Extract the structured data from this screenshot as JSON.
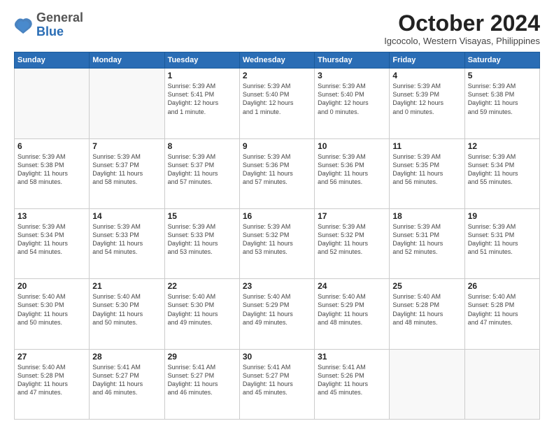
{
  "logo": {
    "general": "General",
    "blue": "Blue"
  },
  "header": {
    "month_title": "October 2024",
    "location": "Igcocolo, Western Visayas, Philippines"
  },
  "weekdays": [
    "Sunday",
    "Monday",
    "Tuesday",
    "Wednesday",
    "Thursday",
    "Friday",
    "Saturday"
  ],
  "weeks": [
    [
      {
        "day": "",
        "info": ""
      },
      {
        "day": "",
        "info": ""
      },
      {
        "day": "1",
        "info": "Sunrise: 5:39 AM\nSunset: 5:41 PM\nDaylight: 12 hours\nand 1 minute."
      },
      {
        "day": "2",
        "info": "Sunrise: 5:39 AM\nSunset: 5:40 PM\nDaylight: 12 hours\nand 1 minute."
      },
      {
        "day": "3",
        "info": "Sunrise: 5:39 AM\nSunset: 5:40 PM\nDaylight: 12 hours\nand 0 minutes."
      },
      {
        "day": "4",
        "info": "Sunrise: 5:39 AM\nSunset: 5:39 PM\nDaylight: 12 hours\nand 0 minutes."
      },
      {
        "day": "5",
        "info": "Sunrise: 5:39 AM\nSunset: 5:38 PM\nDaylight: 11 hours\nand 59 minutes."
      }
    ],
    [
      {
        "day": "6",
        "info": "Sunrise: 5:39 AM\nSunset: 5:38 PM\nDaylight: 11 hours\nand 58 minutes."
      },
      {
        "day": "7",
        "info": "Sunrise: 5:39 AM\nSunset: 5:37 PM\nDaylight: 11 hours\nand 58 minutes."
      },
      {
        "day": "8",
        "info": "Sunrise: 5:39 AM\nSunset: 5:37 PM\nDaylight: 11 hours\nand 57 minutes."
      },
      {
        "day": "9",
        "info": "Sunrise: 5:39 AM\nSunset: 5:36 PM\nDaylight: 11 hours\nand 57 minutes."
      },
      {
        "day": "10",
        "info": "Sunrise: 5:39 AM\nSunset: 5:36 PM\nDaylight: 11 hours\nand 56 minutes."
      },
      {
        "day": "11",
        "info": "Sunrise: 5:39 AM\nSunset: 5:35 PM\nDaylight: 11 hours\nand 56 minutes."
      },
      {
        "day": "12",
        "info": "Sunrise: 5:39 AM\nSunset: 5:34 PM\nDaylight: 11 hours\nand 55 minutes."
      }
    ],
    [
      {
        "day": "13",
        "info": "Sunrise: 5:39 AM\nSunset: 5:34 PM\nDaylight: 11 hours\nand 54 minutes."
      },
      {
        "day": "14",
        "info": "Sunrise: 5:39 AM\nSunset: 5:33 PM\nDaylight: 11 hours\nand 54 minutes."
      },
      {
        "day": "15",
        "info": "Sunrise: 5:39 AM\nSunset: 5:33 PM\nDaylight: 11 hours\nand 53 minutes."
      },
      {
        "day": "16",
        "info": "Sunrise: 5:39 AM\nSunset: 5:32 PM\nDaylight: 11 hours\nand 53 minutes."
      },
      {
        "day": "17",
        "info": "Sunrise: 5:39 AM\nSunset: 5:32 PM\nDaylight: 11 hours\nand 52 minutes."
      },
      {
        "day": "18",
        "info": "Sunrise: 5:39 AM\nSunset: 5:31 PM\nDaylight: 11 hours\nand 52 minutes."
      },
      {
        "day": "19",
        "info": "Sunrise: 5:39 AM\nSunset: 5:31 PM\nDaylight: 11 hours\nand 51 minutes."
      }
    ],
    [
      {
        "day": "20",
        "info": "Sunrise: 5:40 AM\nSunset: 5:30 PM\nDaylight: 11 hours\nand 50 minutes."
      },
      {
        "day": "21",
        "info": "Sunrise: 5:40 AM\nSunset: 5:30 PM\nDaylight: 11 hours\nand 50 minutes."
      },
      {
        "day": "22",
        "info": "Sunrise: 5:40 AM\nSunset: 5:30 PM\nDaylight: 11 hours\nand 49 minutes."
      },
      {
        "day": "23",
        "info": "Sunrise: 5:40 AM\nSunset: 5:29 PM\nDaylight: 11 hours\nand 49 minutes."
      },
      {
        "day": "24",
        "info": "Sunrise: 5:40 AM\nSunset: 5:29 PM\nDaylight: 11 hours\nand 48 minutes."
      },
      {
        "day": "25",
        "info": "Sunrise: 5:40 AM\nSunset: 5:28 PM\nDaylight: 11 hours\nand 48 minutes."
      },
      {
        "day": "26",
        "info": "Sunrise: 5:40 AM\nSunset: 5:28 PM\nDaylight: 11 hours\nand 47 minutes."
      }
    ],
    [
      {
        "day": "27",
        "info": "Sunrise: 5:40 AM\nSunset: 5:28 PM\nDaylight: 11 hours\nand 47 minutes."
      },
      {
        "day": "28",
        "info": "Sunrise: 5:41 AM\nSunset: 5:27 PM\nDaylight: 11 hours\nand 46 minutes."
      },
      {
        "day": "29",
        "info": "Sunrise: 5:41 AM\nSunset: 5:27 PM\nDaylight: 11 hours\nand 46 minutes."
      },
      {
        "day": "30",
        "info": "Sunrise: 5:41 AM\nSunset: 5:27 PM\nDaylight: 11 hours\nand 45 minutes."
      },
      {
        "day": "31",
        "info": "Sunrise: 5:41 AM\nSunset: 5:26 PM\nDaylight: 11 hours\nand 45 minutes."
      },
      {
        "day": "",
        "info": ""
      },
      {
        "day": "",
        "info": ""
      }
    ]
  ]
}
